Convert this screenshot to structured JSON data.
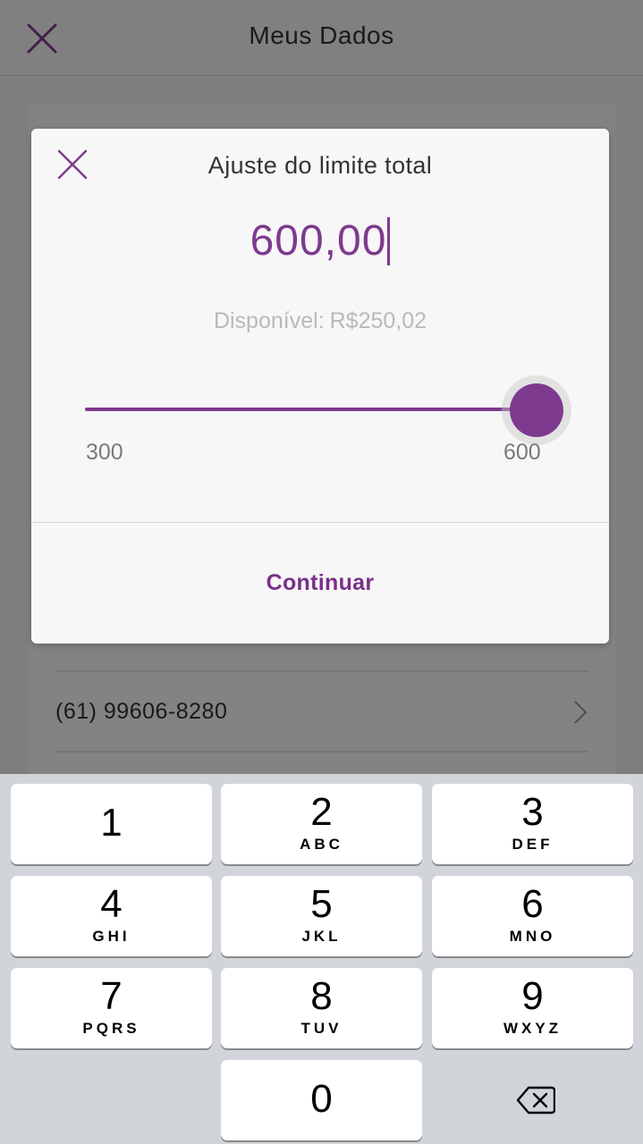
{
  "app": {
    "title": "Meus Dados",
    "phone": "(61) 99606-8280"
  },
  "dialog": {
    "title": "Ajuste do limite total",
    "amount": "600,00",
    "available_label": "Disponível:",
    "available_value": "R$250,02",
    "slider": {
      "min_label": "300",
      "max_label": "600",
      "min": 300,
      "max": 600,
      "value": 600
    },
    "continue_label": "Continuar"
  },
  "keyboard": {
    "keys": [
      {
        "digit": "1",
        "letters": ""
      },
      {
        "digit": "2",
        "letters": "ABC"
      },
      {
        "digit": "3",
        "letters": "DEF"
      },
      {
        "digit": "4",
        "letters": "GHI"
      },
      {
        "digit": "5",
        "letters": "JKL"
      },
      {
        "digit": "6",
        "letters": "MNO"
      },
      {
        "digit": "7",
        "letters": "PQRS"
      },
      {
        "digit": "8",
        "letters": "TUV"
      },
      {
        "digit": "9",
        "letters": "WXYZ"
      },
      {
        "digit": "0",
        "letters": ""
      }
    ]
  },
  "colors": {
    "accent": "#7e3a8e",
    "keyboard_bg": "#d1d4d9"
  },
  "icons": {
    "app_close": "close-icon",
    "dialog_close": "close-icon",
    "row_chevron": "chevron-right-icon",
    "delete": "backspace-icon"
  }
}
